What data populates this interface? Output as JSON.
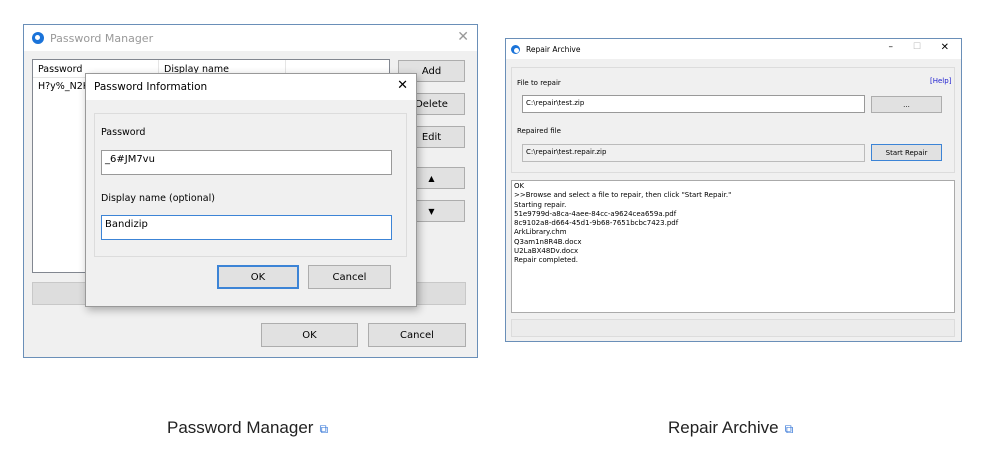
{
  "password_manager": {
    "title": "Password Manager",
    "columns": [
      "Password",
      "Display name"
    ],
    "rows": [
      {
        "password": "H?y%_N2K"
      }
    ],
    "buttons": {
      "add": "Add",
      "delete": "Delete",
      "edit": "Edit",
      "up": "▲",
      "down": "▼",
      "ok": "OK",
      "cancel": "Cancel"
    },
    "dialog": {
      "title": "Password Information",
      "password_label": "Password",
      "password_value": "_6#JM7vu",
      "display_label": "Display name (optional)",
      "display_value": "Bandizip",
      "ok": "OK",
      "cancel": "Cancel"
    }
  },
  "repair_archive": {
    "title": "Repair Archive",
    "file_label": "File to repair",
    "help": "[Help]",
    "file_value": "C:\\repair\\test.zip",
    "browse": "...",
    "repaired_label": "Repaired file",
    "repaired_value": "C:\\repair\\test.repair.zip",
    "start": "Start Repair",
    "log": [
      "OK",
      ">>Browse and select a file to repair, then click \"Start Repair.\"",
      "Starting repair.",
      "51e9799d-a8ca-4aee-84cc-a9624cea659a.pdf",
      "8c9102a8-d664-45d1-9b68-7651bcbc7423.pdf",
      "ArkLibrary.chm",
      "Q3am1n8R4B.docx",
      "U2LaBX48Dv.docx",
      "Repair completed."
    ]
  },
  "captions": {
    "left": "Password Manager",
    "right": "Repair Archive",
    "link_icon": "⧉"
  }
}
